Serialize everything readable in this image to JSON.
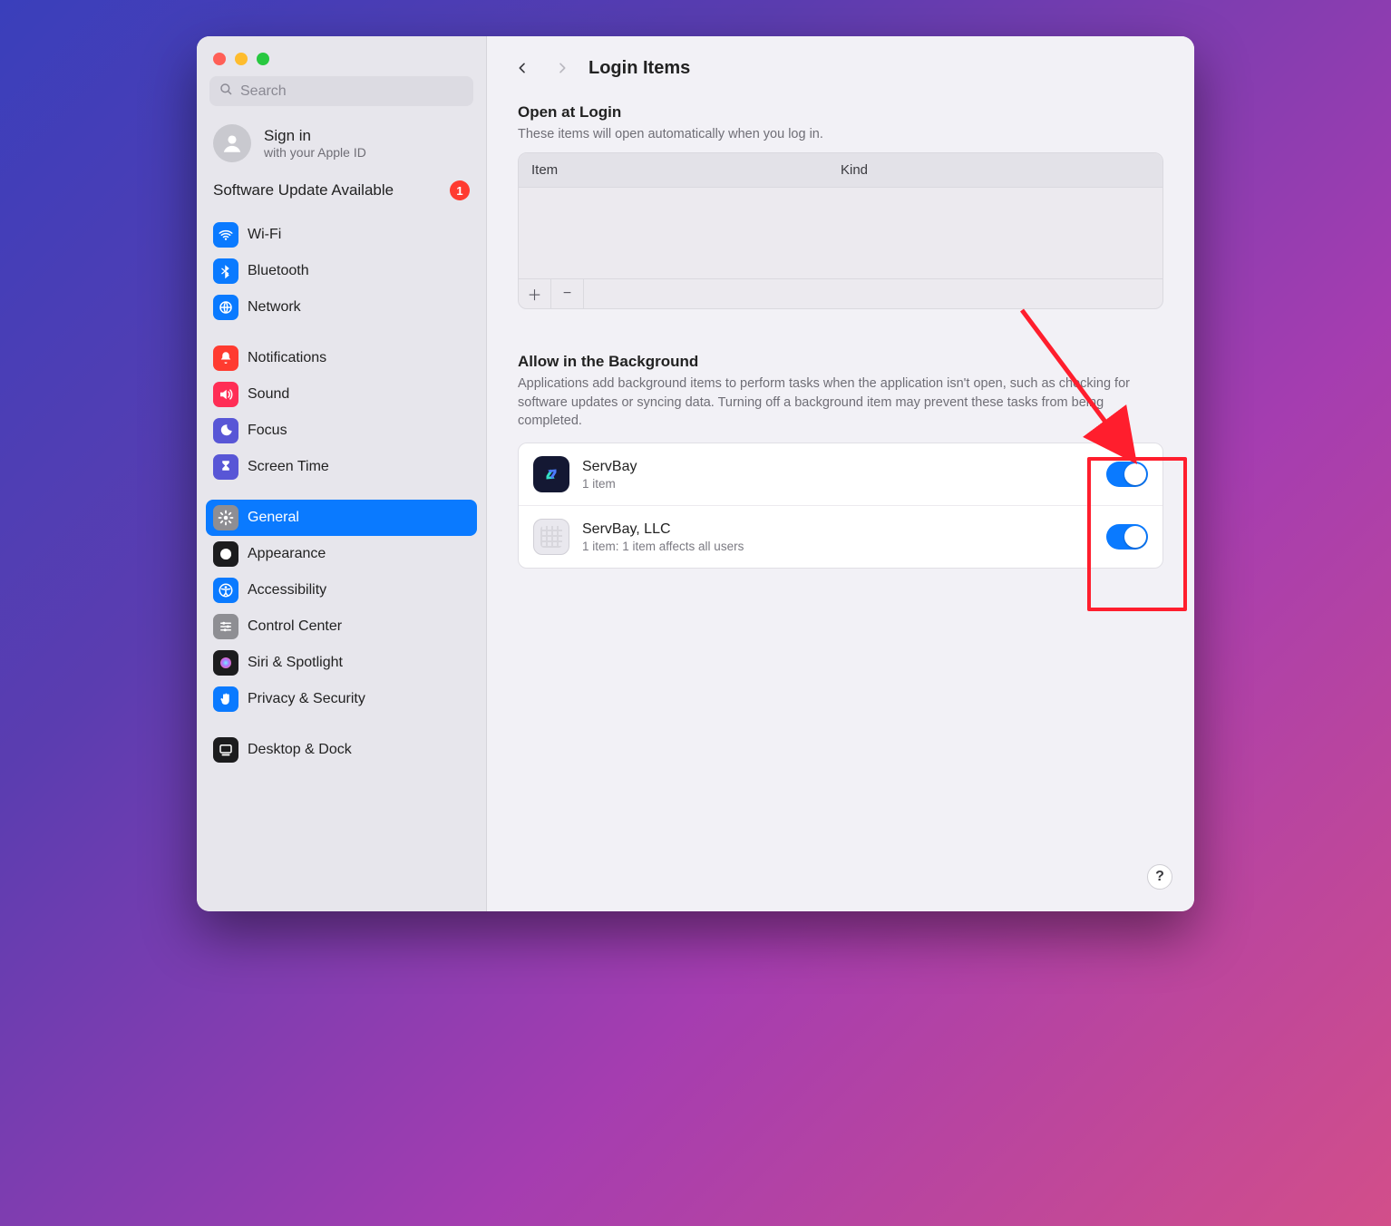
{
  "search": {
    "placeholder": "Search"
  },
  "account": {
    "title": "Sign in",
    "subtitle": "with your Apple ID"
  },
  "update": {
    "label": "Software Update Available",
    "count": "1"
  },
  "sidebar": {
    "items": [
      {
        "label": "Wi-Fi",
        "bg": "#0a7aff",
        "icon": "wifi"
      },
      {
        "label": "Bluetooth",
        "bg": "#0a7aff",
        "icon": "bluetooth"
      },
      {
        "label": "Network",
        "bg": "#0a7aff",
        "icon": "network"
      },
      {
        "label": "Notifications",
        "bg": "#ff3b30",
        "icon": "bell"
      },
      {
        "label": "Sound",
        "bg": "#ff2d55",
        "icon": "sound"
      },
      {
        "label": "Focus",
        "bg": "#5856d6",
        "icon": "moon"
      },
      {
        "label": "Screen Time",
        "bg": "#5856d6",
        "icon": "hourglass"
      },
      {
        "label": "General",
        "bg": "#8e8e93",
        "icon": "gear",
        "active": true
      },
      {
        "label": "Appearance",
        "bg": "#1c1c1e",
        "icon": "appearance"
      },
      {
        "label": "Accessibility",
        "bg": "#0a7aff",
        "icon": "accessibility"
      },
      {
        "label": "Control Center",
        "bg": "#8e8e93",
        "icon": "sliders"
      },
      {
        "label": "Siri & Spotlight",
        "bg": "#1c1c1e",
        "icon": "siri"
      },
      {
        "label": "Privacy & Security",
        "bg": "#0a7aff",
        "icon": "hand"
      },
      {
        "label": "Desktop & Dock",
        "bg": "#1c1c1e",
        "icon": "dock"
      }
    ],
    "breaks": [
      3,
      7,
      13
    ]
  },
  "main": {
    "title": "Login Items",
    "open_at_login": {
      "heading": "Open at Login",
      "desc": "These items will open automatically when you log in.",
      "cols": {
        "item": "Item",
        "kind": "Kind"
      },
      "rows": []
    },
    "background": {
      "heading": "Allow in the Background",
      "desc": "Applications add background items to perform tasks when the application isn't open, such as checking for software updates or syncing data. Turning off a background item may prevent these tasks from being completed.",
      "rows": [
        {
          "name": "ServBay",
          "sub": "1 item",
          "on": true,
          "iconClass": "sb1"
        },
        {
          "name": "ServBay, LLC",
          "sub": "1 item: 1 item affects all users",
          "on": true,
          "iconClass": "sb2"
        }
      ]
    },
    "help_label": "?"
  },
  "glyphs": {
    "plus": "＋",
    "minus": "−"
  }
}
